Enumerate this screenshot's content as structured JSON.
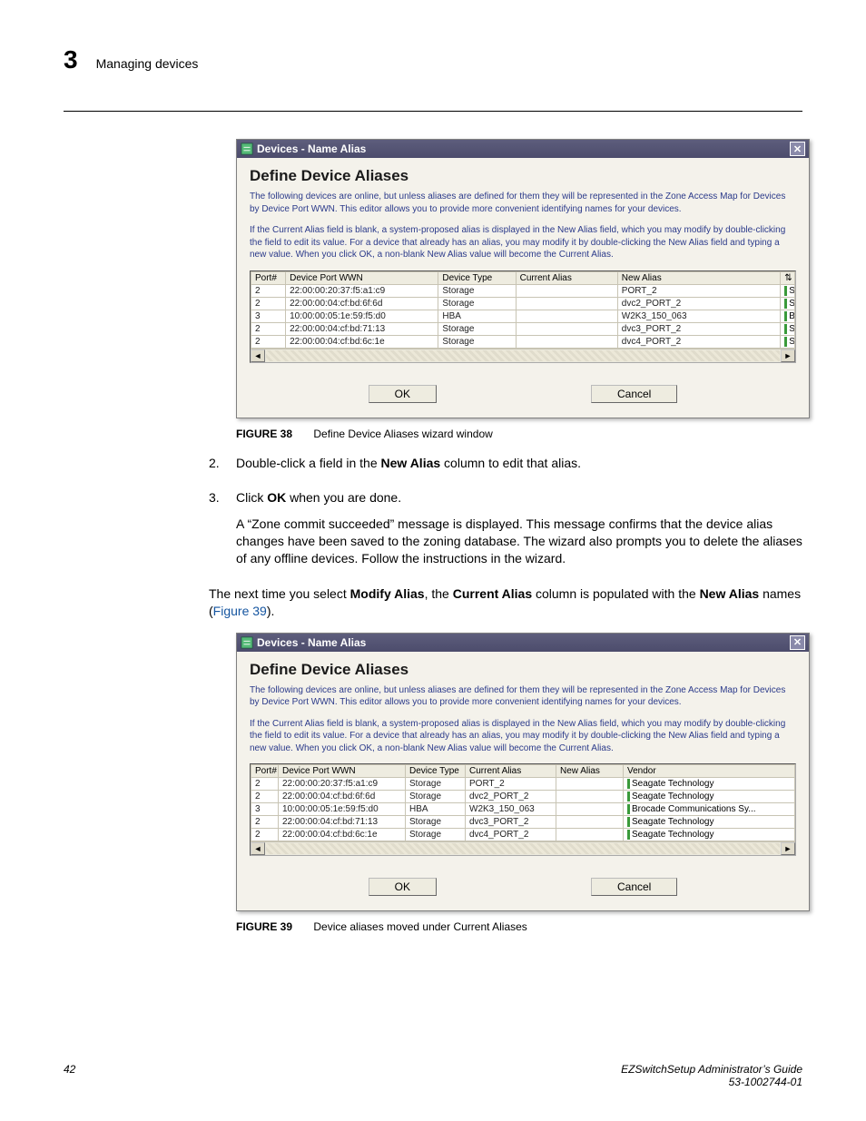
{
  "header": {
    "chapter": "3",
    "title": "Managing devices"
  },
  "dialog1": {
    "titlebar": "Devices - Name Alias",
    "heading": "Define Device Aliases",
    "desc1": "The following devices are online, but unless aliases are defined for them they will be represented in the Zone Access Map for Devices by Device Port WWN. This editor allows you to provide more convenient identifying names for your devices.",
    "desc2": "If the Current Alias field is blank, a system-proposed alias is displayed in the New Alias field, which you may modify by double-clicking the field to edit its value. For a device that already has an alias, you may modify it by double-clicking the New Alias field and typing a new value. When you click OK, a non-blank New Alias value will become the Current Alias.",
    "cols": [
      "Port#",
      "Device Port WWN",
      "Device Type",
      "Current Alias",
      "New Alias"
    ],
    "rows": [
      {
        "port": "2",
        "wwn": "22:00:00:20:37:f5:a1:c9",
        "type": "Storage",
        "curr": "",
        "newa": "PORT_2",
        "end": "S"
      },
      {
        "port": "2",
        "wwn": "22:00:00:04:cf:bd:6f:6d",
        "type": "Storage",
        "curr": "",
        "newa": "dvc2_PORT_2",
        "end": "S"
      },
      {
        "port": "3",
        "wwn": "10:00:00:05:1e:59:f5:d0",
        "type": "HBA",
        "curr": "",
        "newa": "W2K3_150_063",
        "end": "B"
      },
      {
        "port": "2",
        "wwn": "22:00:00:04:cf:bd:71:13",
        "type": "Storage",
        "curr": "",
        "newa": "dvc3_PORT_2",
        "end": "S"
      },
      {
        "port": "2",
        "wwn": "22:00:00:04:cf:bd:6c:1e",
        "type": "Storage",
        "curr": "",
        "newa": "dvc4_PORT_2",
        "end": "S"
      }
    ],
    "ok": "OK",
    "cancel": "Cancel"
  },
  "fig38": {
    "num": "FIGURE 38",
    "cap": "Define Device Aliases wizard window"
  },
  "steps": {
    "s2_num": "2.",
    "s2_a": "Double-click a field in the ",
    "s2_b": "New Alias",
    "s2_c": " column to edit that alias.",
    "s3_num": "3.",
    "s3_a": "Click ",
    "s3_b": "OK",
    "s3_c": " when you are done.",
    "s3_p": "A “Zone commit succeeded” message is displayed. This message confirms that the device alias changes have been saved to the zoning database. The wizard also prompts you to delete the aliases of any offline devices. Follow the instructions in the wizard."
  },
  "para_a": "The next time you select ",
  "para_b": "Modify Alias",
  "para_c": ", the ",
  "para_d": "Current Alias",
  "para_e": " column is populated with the ",
  "para_f": "New Alias",
  "para_g": " names (",
  "para_link": "Figure 39",
  "para_h": ").",
  "dialog2": {
    "titlebar": "Devices - Name Alias",
    "heading": "Define Device Aliases",
    "desc1": "The following devices are online, but unless aliases are defined for them they will be represented in the Zone Access Map for Devices by Device Port WWN. This editor allows you to provide more convenient identifying names for your devices.",
    "desc2": "If the Current Alias field is blank, a system-proposed alias is displayed in the New Alias field, which you may modify by double-clicking the field to edit its value. For a device that already has an alias, you may modify it by double-clicking the New Alias field and typing a new value. When you click OK, a non-blank New Alias value will become the Current Alias.",
    "cols": [
      "Port#",
      "Device Port WWN",
      "Device Type",
      "Current Alias",
      "New Alias",
      "Vendor"
    ],
    "rows": [
      {
        "port": "2",
        "wwn": "22:00:00:20:37:f5:a1:c9",
        "type": "Storage",
        "curr": "PORT_2",
        "newa": "",
        "vendor": "Seagate Technology"
      },
      {
        "port": "2",
        "wwn": "22:00:00:04:cf:bd:6f:6d",
        "type": "Storage",
        "curr": "dvc2_PORT_2",
        "newa": "",
        "vendor": "Seagate Technology"
      },
      {
        "port": "3",
        "wwn": "10:00:00:05:1e:59:f5:d0",
        "type": "HBA",
        "curr": "W2K3_150_063",
        "newa": "",
        "vendor": "Brocade Communications Sy..."
      },
      {
        "port": "2",
        "wwn": "22:00:00:04:cf:bd:71:13",
        "type": "Storage",
        "curr": "dvc3_PORT_2",
        "newa": "",
        "vendor": "Seagate Technology"
      },
      {
        "port": "2",
        "wwn": "22:00:00:04:cf:bd:6c:1e",
        "type": "Storage",
        "curr": "dvc4_PORT_2",
        "newa": "",
        "vendor": "Seagate Technology"
      }
    ],
    "ok": "OK",
    "cancel": "Cancel"
  },
  "fig39": {
    "num": "FIGURE 39",
    "cap": "Device aliases moved under Current Aliases"
  },
  "footer": {
    "page": "42",
    "r1": "EZSwitchSetup Administrator’s Guide",
    "r2": "53-1002744-01"
  }
}
